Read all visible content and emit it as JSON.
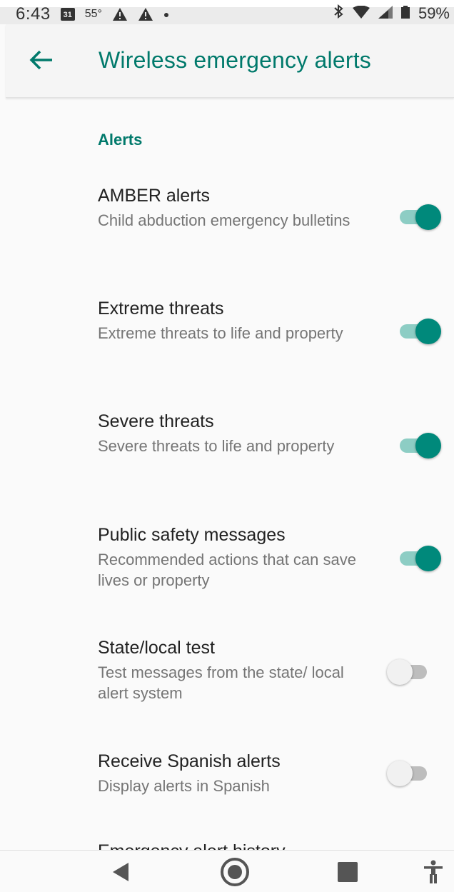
{
  "status_bar": {
    "time": "6:43",
    "calendar_day": "31",
    "temperature": "55°",
    "battery": "59%"
  },
  "app_bar": {
    "title": "Wireless emergency alerts",
    "back_icon": "arrow-back-icon"
  },
  "section": {
    "header": "Alerts"
  },
  "preferences": [
    {
      "title": "AMBER alerts",
      "summary": "Child abduction emergency bulletins",
      "enabled": true
    },
    {
      "title": "Extreme threats",
      "summary": "Extreme threats to life and property",
      "enabled": true
    },
    {
      "title": "Severe threats",
      "summary": "Severe threats to life and property",
      "enabled": true
    },
    {
      "title": "Public safety messages",
      "summary": "Recommended actions that can save lives or property",
      "enabled": true
    },
    {
      "title": "State/local test",
      "summary": "Test messages from the state/ local alert system",
      "enabled": false
    },
    {
      "title": "Receive Spanish alerts",
      "summary": "Display alerts in Spanish",
      "enabled": false
    }
  ],
  "partial_item": {
    "title": "Emergency alert history"
  },
  "colors": {
    "accent": "#00796b",
    "toggle_on_thumb": "#00897b",
    "toggle_on_track": "#8dcdc4",
    "toggle_off_thumb": "#f1f1f1",
    "toggle_off_track": "#bdbdbd"
  },
  "nav_bar": {
    "back_icon": "nav-back-icon",
    "home_icon": "nav-home-icon",
    "recents_icon": "nav-recents-icon",
    "accessibility_icon": "accessibility-icon"
  }
}
